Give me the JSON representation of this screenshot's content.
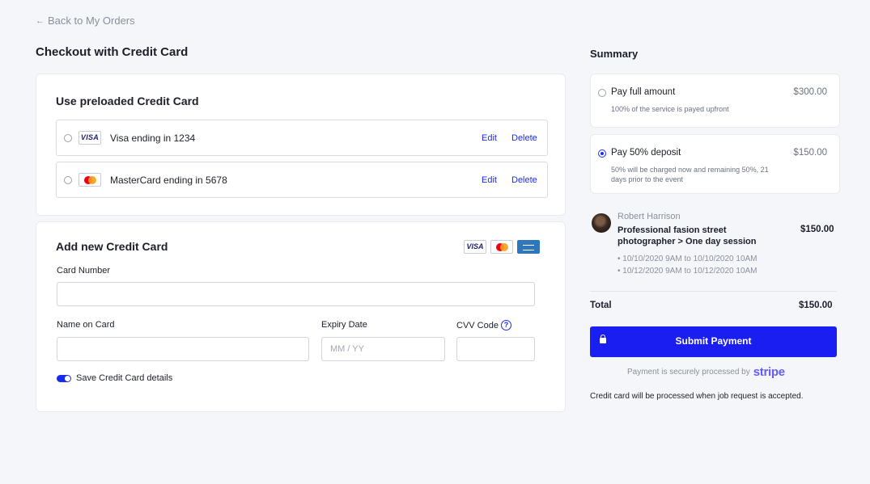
{
  "nav": {
    "back_arrow": "←",
    "back_label": "Back to My Orders"
  },
  "page": {
    "title": "Checkout with Credit Card"
  },
  "preloaded": {
    "title": "Use preloaded Credit Card",
    "cards": [
      {
        "brand": "visa",
        "brand_label": "VISA",
        "label": "Visa ending in 1234",
        "edit": "Edit",
        "delete": "Delete"
      },
      {
        "brand": "mastercard",
        "label": "MasterCard ending in 5678",
        "edit": "Edit",
        "delete": "Delete"
      }
    ]
  },
  "new_card": {
    "title": "Add new Credit Card",
    "accepted_brands": [
      "visa",
      "mastercard",
      "amex"
    ],
    "visa_label": "VISA",
    "card_number_label": "Card Number",
    "card_number_value": "",
    "name_label": "Name on Card",
    "name_value": "",
    "expiry_label": "Expiry Date",
    "expiry_placeholder": "MM / YY",
    "cvv_label": "CVV Code",
    "cvv_help": "?",
    "cvv_value": "",
    "save_label": "Save Credit Card details",
    "save_enabled": true
  },
  "summary": {
    "title": "Summary",
    "options": [
      {
        "title": "Pay full amount",
        "price": "$300.00",
        "desc": "100% of the service is payed upfront",
        "selected": false
      },
      {
        "title": "Pay 50% deposit",
        "price": "$150.00",
        "desc": "50% will be charged now and remaining 50%, 21 days prior to the event",
        "selected": true
      }
    ],
    "seller": "Robert Harrison",
    "service": "Professional fasion street photographer > One day session",
    "service_price": "$150.00",
    "dates": [
      "10/10/2020 9AM to 10/10/2020 10AM",
      "10/12/2020 9AM to 10/12/2020 10AM"
    ],
    "total_label": "Total",
    "total_value": "$150.00",
    "submit_label": "Submit Payment",
    "secure_text": "Payment is securely processed by",
    "processor": "stripe",
    "note": "Credit card will be processed when job request is accepted."
  },
  "colors": {
    "accent": "#1a1ef0",
    "stripe": "#635bff",
    "background": "#f4f6f9"
  }
}
